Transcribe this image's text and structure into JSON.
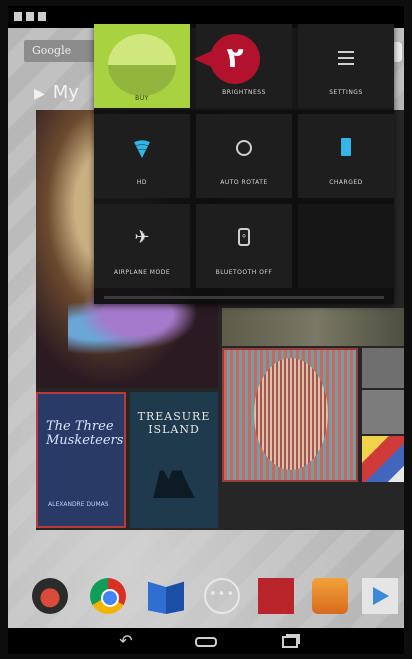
{
  "home": {
    "search_text": "Google",
    "play_text": "My"
  },
  "books": [
    {
      "title": "The Three Musketeers",
      "author": "ALEXANDRE DUMAS"
    },
    {
      "title": "TREASURE ISLAND"
    }
  ],
  "dock": {
    "apps_label": "•••"
  },
  "quick_settings": {
    "tiles": [
      {
        "label": "BUY",
        "icon": "user-avatar-icon"
      },
      {
        "label": "BRIGHTNESS",
        "icon": "brightness-icon"
      },
      {
        "label": "SETTINGS",
        "icon": "settings-sliders-icon"
      },
      {
        "label": "HD",
        "icon": "wifi-icon"
      },
      {
        "label": "AUTO ROTATE",
        "icon": "auto-rotate-icon"
      },
      {
        "label": "CHARGED",
        "icon": "battery-icon"
      },
      {
        "label": "AIRPLANE MODE",
        "icon": "airplane-icon"
      },
      {
        "label": "BLUETOOTH OFF",
        "icon": "bluetooth-icon"
      }
    ]
  },
  "callout": {
    "number": "٢",
    "color": "#b3122c"
  },
  "colors": {
    "user_tile": "#a9d240",
    "accent_blue": "#33b5e5"
  }
}
